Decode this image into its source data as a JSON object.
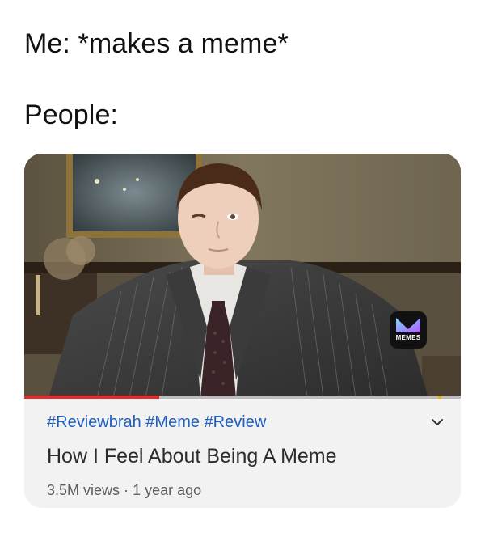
{
  "caption": {
    "line1": "Me: *makes a meme*",
    "line2": "People:"
  },
  "video": {
    "hashtags": [
      "#Reviewbrah",
      "#Meme",
      "#Review"
    ],
    "title": "How I Feel About Being A Meme",
    "views": "3.5M views",
    "separator": "·",
    "age": "1 year ago",
    "progress_fraction": 0.31,
    "expand_icon": "chevron-down-icon"
  },
  "watermark": {
    "label": "MEMES"
  },
  "colors": {
    "hashtag": "#1f5fbf",
    "progress": "#e52b2b",
    "progress_marker": "#f0b400",
    "card_background": "#f2f2f2"
  }
}
